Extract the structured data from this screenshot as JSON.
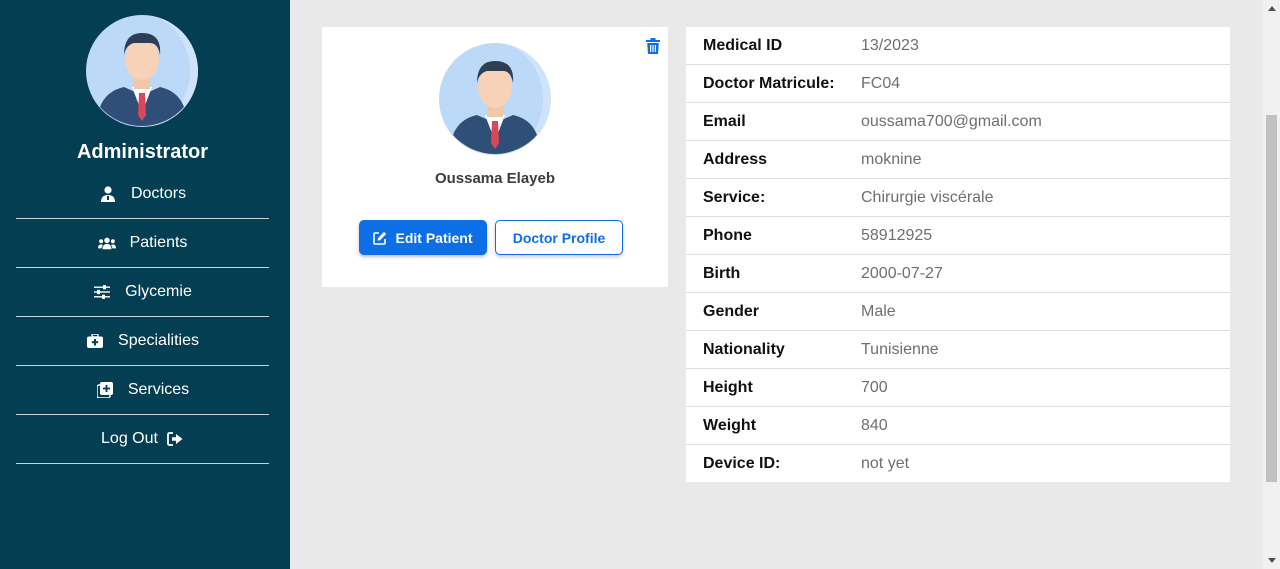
{
  "sidebar": {
    "role": "Administrator",
    "items": [
      {
        "label": "Doctors",
        "icon": "doctor-icon"
      },
      {
        "label": "Patients",
        "icon": "users-icon"
      },
      {
        "label": "Glycemie",
        "icon": "sliders-icon"
      },
      {
        "label": "Specialities",
        "icon": "medkit-icon"
      },
      {
        "label": "Services",
        "icon": "plus-square-icon"
      },
      {
        "label": "Log Out",
        "icon": "logout-icon"
      }
    ]
  },
  "profile": {
    "name": "Oussama Elayeb",
    "edit_label": "Edit Patient",
    "doctor_profile_label": "Doctor Profile"
  },
  "details": [
    {
      "key": "Medical ID",
      "value": "13/2023"
    },
    {
      "key": "Doctor Matricule:",
      "value": "FC04"
    },
    {
      "key": "Email",
      "value": "oussama700@gmail.com"
    },
    {
      "key": "Address",
      "value": "moknine"
    },
    {
      "key": "Service:",
      "value": "Chirurgie viscérale"
    },
    {
      "key": "Phone",
      "value": "58912925"
    },
    {
      "key": "Birth",
      "value": "2000-07-27"
    },
    {
      "key": "Gender",
      "value": "Male"
    },
    {
      "key": "Nationality",
      "value": "Tunisienne"
    },
    {
      "key": "Height",
      "value": "700"
    },
    {
      "key": "Weight",
      "value": "840"
    },
    {
      "key": "Device ID:",
      "value": "not yet"
    }
  ],
  "colors": {
    "sidebar_bg": "#033e52",
    "accent": "#0d6fe8",
    "page_bg": "#e9e9e9"
  }
}
